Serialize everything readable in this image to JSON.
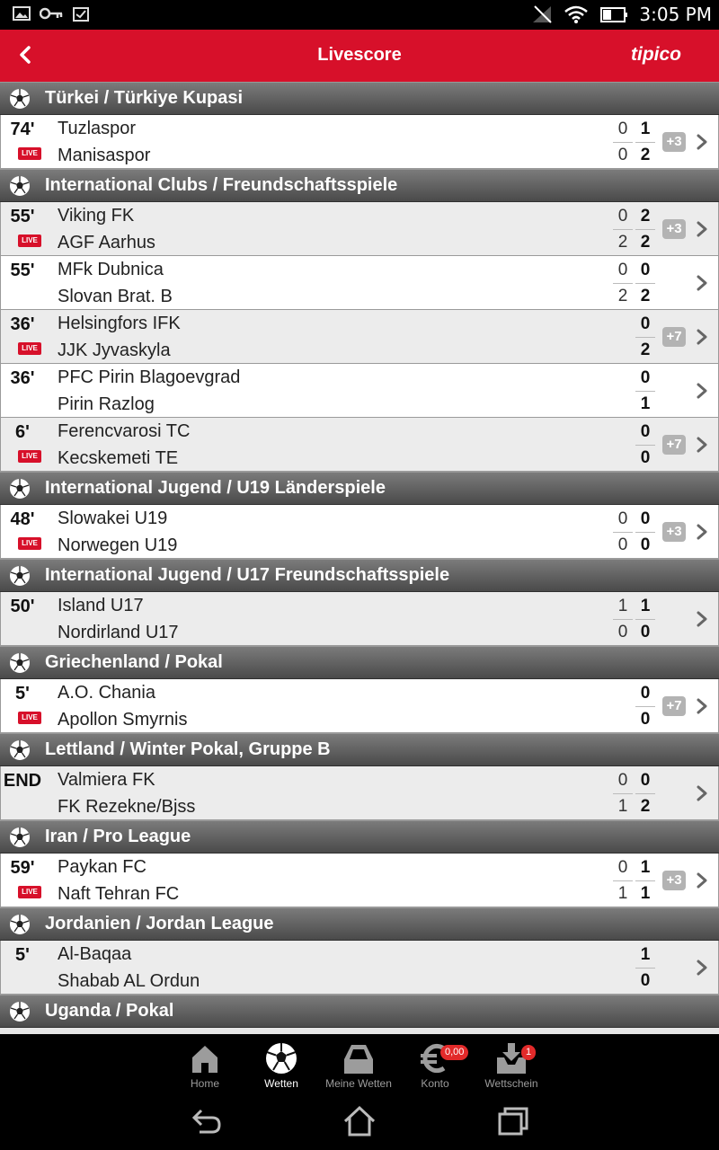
{
  "status_bar": {
    "time": "3:05 PM"
  },
  "app_bar": {
    "title": "Livescore",
    "brand": "tipico"
  },
  "colors": {
    "brand_red": "#d7102a",
    "live_red": "#d7102a",
    "badge_red": "#e22a2a"
  },
  "live_label": "LIVE",
  "sections": [
    {
      "league": "Türkei / Türkiye Kupasi",
      "matches": [
        {
          "minute": "74'",
          "live": true,
          "home": "Tuzlaspor",
          "away": "Manisaspor",
          "ht_home": "0",
          "ft_home": "1",
          "ht_away": "0",
          "ft_away": "2",
          "odds": "+3"
        }
      ]
    },
    {
      "league": "International Clubs / Freundschaftsspiele",
      "matches": [
        {
          "minute": "55'",
          "live": true,
          "home": "Viking FK",
          "away": "AGF Aarhus",
          "ht_home": "0",
          "ft_home": "2",
          "ht_away": "2",
          "ft_away": "2",
          "odds": "+3"
        },
        {
          "minute": "55'",
          "live": false,
          "home": "MFk Dubnica",
          "away": "Slovan Brat. B",
          "ht_home": "0",
          "ft_home": "0",
          "ht_away": "2",
          "ft_away": "2",
          "odds": ""
        },
        {
          "minute": "36'",
          "live": true,
          "home": "Helsingfors IFK",
          "away": "JJK Jyvaskyla",
          "ht_home": "",
          "ft_home": "0",
          "ht_away": "",
          "ft_away": "2",
          "odds": "+7"
        },
        {
          "minute": "36'",
          "live": false,
          "home": "PFC Pirin Blagoevgrad",
          "away": "Pirin Razlog",
          "ht_home": "",
          "ft_home": "0",
          "ht_away": "",
          "ft_away": "1",
          "odds": ""
        },
        {
          "minute": "6'",
          "live": true,
          "home": "Ferencvarosi TC",
          "away": "Kecskemeti TE",
          "ht_home": "",
          "ft_home": "0",
          "ht_away": "",
          "ft_away": "0",
          "odds": "+7"
        }
      ]
    },
    {
      "league": "International Jugend / U19 Länderspiele",
      "matches": [
        {
          "minute": "48'",
          "live": true,
          "home": "Slowakei U19",
          "away": "Norwegen U19",
          "ht_home": "0",
          "ft_home": "0",
          "ht_away": "0",
          "ft_away": "0",
          "odds": "+3"
        }
      ]
    },
    {
      "league": "International Jugend / U17 Freundschaftsspiele",
      "matches": [
        {
          "minute": "50'",
          "live": false,
          "home": "Island U17",
          "away": "Nordirland U17",
          "ht_home": "1",
          "ft_home": "1",
          "ht_away": "0",
          "ft_away": "0",
          "odds": ""
        }
      ]
    },
    {
      "league": "Griechenland / Pokal",
      "matches": [
        {
          "minute": "5'",
          "live": true,
          "home": "A.O. Chania",
          "away": "Apollon Smyrnis",
          "ht_home": "",
          "ft_home": "0",
          "ht_away": "",
          "ft_away": "0",
          "odds": "+7"
        }
      ]
    },
    {
      "league": "Lettland / Winter Pokal, Gruppe B",
      "matches": [
        {
          "minute": "END",
          "live": false,
          "home": "Valmiera FK",
          "away": "FK Rezekne/Bjss",
          "ht_home": "0",
          "ft_home": "0",
          "ht_away": "1",
          "ft_away": "2",
          "odds": ""
        }
      ]
    },
    {
      "league": "Iran / Pro League",
      "matches": [
        {
          "minute": "59'",
          "live": true,
          "home": "Paykan FC",
          "away": "Naft Tehran FC",
          "ht_home": "0",
          "ft_home": "1",
          "ht_away": "1",
          "ft_away": "1",
          "odds": "+3"
        }
      ]
    },
    {
      "league": "Jordanien / Jordan League",
      "matches": [
        {
          "minute": "5'",
          "live": false,
          "home": "Al-Baqaa",
          "away": "Shabab AL Ordun",
          "ht_home": "",
          "ft_home": "1",
          "ht_away": "",
          "ft_away": "0",
          "odds": ""
        }
      ]
    },
    {
      "league": "Uganda / Pokal",
      "matches": []
    }
  ],
  "bottom_nav": [
    {
      "label": "Home",
      "icon": "home-icon",
      "active": false
    },
    {
      "label": "Wetten",
      "icon": "soccer-ball-icon",
      "active": true
    },
    {
      "label": "Meine Wetten",
      "icon": "my-bets-icon",
      "active": false
    },
    {
      "label": "Konto",
      "icon": "euro-icon",
      "active": false,
      "badge": "0,00"
    },
    {
      "label": "Wettschein",
      "icon": "bet-slip-icon",
      "active": false,
      "badge": "1"
    }
  ],
  "system_nav": [
    {
      "icon": "back-icon"
    },
    {
      "icon": "home-icon"
    },
    {
      "icon": "recent-apps-icon"
    }
  ]
}
